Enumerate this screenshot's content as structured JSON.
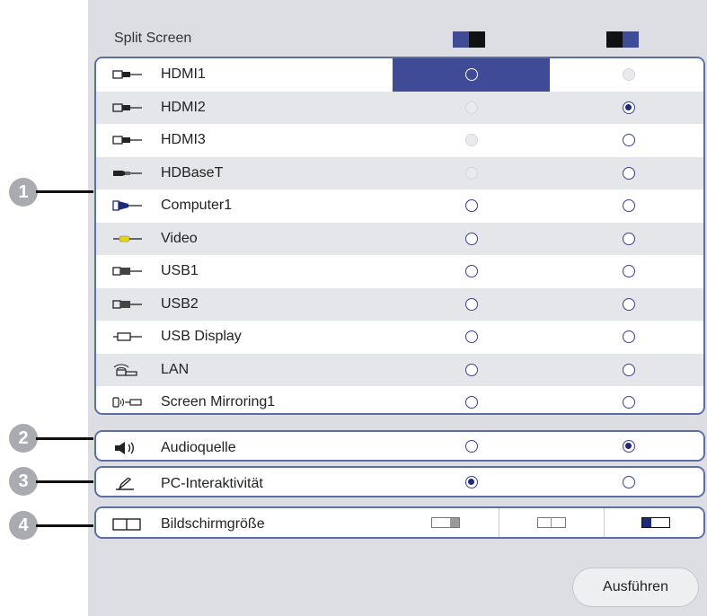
{
  "title": "Split Screen",
  "sources": [
    {
      "label": "HDMI1",
      "icon": "hdmi-icon",
      "left": "selected",
      "right": "disabled"
    },
    {
      "label": "HDMI2",
      "icon": "hdmi-icon",
      "left": "disabled",
      "right": "checked"
    },
    {
      "label": "HDMI3",
      "icon": "hdmi-icon",
      "left": "disabled",
      "right": "empty"
    },
    {
      "label": "HDBaseT",
      "icon": "hdbaset-icon",
      "left": "disabled",
      "right": "empty"
    },
    {
      "label": "Computer1",
      "icon": "vga-icon",
      "left": "empty",
      "right": "empty"
    },
    {
      "label": "Video",
      "icon": "video-icon",
      "left": "empty",
      "right": "empty"
    },
    {
      "label": "USB1",
      "icon": "usb-icon",
      "left": "empty",
      "right": "empty"
    },
    {
      "label": "USB2",
      "icon": "usb-icon",
      "left": "empty",
      "right": "empty"
    },
    {
      "label": "USB Display",
      "icon": "usb-display-icon",
      "left": "empty",
      "right": "empty"
    },
    {
      "label": "LAN",
      "icon": "lan-icon",
      "left": "empty",
      "right": "empty"
    },
    {
      "label": "Screen Mirroring1",
      "icon": "screen-mirroring-icon",
      "left": "empty",
      "right": "empty"
    }
  ],
  "audio": {
    "label": "Audioquelle",
    "left": "empty",
    "right": "checked"
  },
  "interactivity": {
    "label": "PC-Interaktivität",
    "left": "checked",
    "right": "empty"
  },
  "screen_size": {
    "label": "Bildschirmgröße"
  },
  "callouts": [
    "1",
    "2",
    "3",
    "4"
  ],
  "execute_button": "Ausführen",
  "colors": {
    "accent": "#3f4b97",
    "border": "#5b6ea6",
    "panel": "#dcdee3"
  }
}
